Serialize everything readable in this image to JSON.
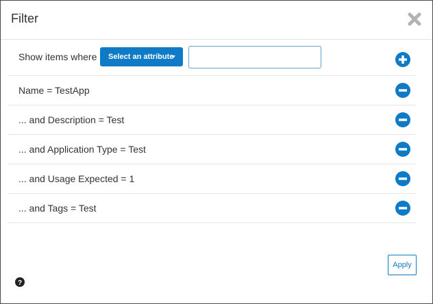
{
  "dialog": {
    "title": "Filter",
    "close_icon": "close-icon"
  },
  "criteria": {
    "label": "Show items where",
    "attribute_select_label": "Select an attribute",
    "value_input": "",
    "add_icon": "plus-circle-icon"
  },
  "filters": [
    {
      "text": "Name = TestApp",
      "remove_icon": "minus-circle-icon"
    },
    {
      "text": "... and Description = Test",
      "remove_icon": "minus-circle-icon"
    },
    {
      "text": "... and Application Type = Test",
      "remove_icon": "minus-circle-icon"
    },
    {
      "text": "... and Usage Expected = 1",
      "remove_icon": "minus-circle-icon"
    },
    {
      "text": "... and Tags = Test",
      "remove_icon": "minus-circle-icon"
    }
  ],
  "footer": {
    "apply_label": "Apply",
    "help_icon": "help-icon"
  },
  "colors": {
    "accent": "#0f7ac6",
    "text": "#333333",
    "divider": "#e5e5e5"
  }
}
